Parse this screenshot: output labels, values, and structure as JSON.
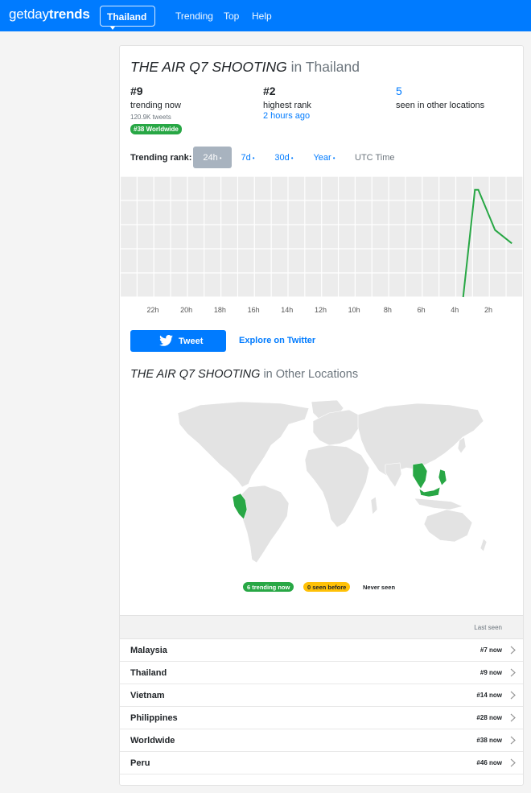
{
  "navbar": {
    "brand": {
      "part1": "get",
      "part2": "day",
      "part3": "trends"
    },
    "location_button": "Thailand",
    "links": [
      "Trending",
      "Top",
      "Help"
    ]
  },
  "trend": {
    "name": "THE AIR Q7 SHOOTING",
    "location_suffix": "in Thailand"
  },
  "stats": {
    "current": {
      "rank": "#9",
      "label": "trending now",
      "tweets": "120.9K tweets",
      "worldwide_badge": "#38 Worldwide"
    },
    "highest": {
      "rank": "#2",
      "label": "highest rank",
      "when": "2 hours ago"
    },
    "other": {
      "count": "5",
      "label": "seen in other locations"
    }
  },
  "rank_filter": {
    "label": "Trending rank:",
    "options": [
      "24h",
      "7d",
      "30d",
      "Year"
    ],
    "active": "24h",
    "dot": "•",
    "utc": "UTC Time"
  },
  "chart_data": {
    "type": "line",
    "x_tick_labels": [
      "22h",
      "20h",
      "18h",
      "16h",
      "14h",
      "12h",
      "10h",
      "8h",
      "6h",
      "4h",
      "2h"
    ],
    "x": [
      -3.5,
      -2.8,
      -2.6,
      -1.6,
      -0.6
    ],
    "y": [
      55,
      2,
      2,
      5,
      6
    ],
    "ylim": [
      1,
      10
    ],
    "inverted_y": true,
    "grid": true,
    "line_color": "#28a745"
  },
  "actions": {
    "tweet": "Tweet",
    "explore": "Explore on Twitter"
  },
  "other_locations": {
    "title_suffix": "in Other Locations",
    "legend": {
      "trending": "6 trending now",
      "seen_before": "0 seen before",
      "never": "Never seen"
    },
    "highlight_color": "#28a745",
    "land_color": "#e3e3e3"
  },
  "table": {
    "last_seen_header": "Last seen",
    "rows": [
      {
        "name": "Malaysia",
        "rank": "#7 now"
      },
      {
        "name": "Thailand",
        "rank": "#9 now"
      },
      {
        "name": "Vietnam",
        "rank": "#14 now"
      },
      {
        "name": "Philippines",
        "rank": "#28 now"
      },
      {
        "name": "Worldwide",
        "rank": "#38 now"
      },
      {
        "name": "Peru",
        "rank": "#46 now"
      }
    ]
  }
}
